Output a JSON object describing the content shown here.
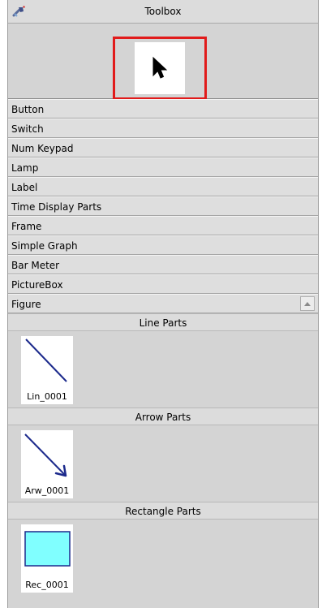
{
  "panel": {
    "title": "Toolbox",
    "title_icon": "toolbox-wrench-icon",
    "pointer_tool": "arrow-cursor-icon",
    "highlight_color": "#e11b1b"
  },
  "categories": [
    "Button",
    "Switch",
    "Num Keypad",
    "Lamp",
    "Label",
    "Time Display Parts",
    "Frame",
    "Simple Graph",
    "Bar Meter",
    "PictureBox",
    "Figure"
  ],
  "sections": [
    {
      "title": "Line Parts",
      "item": "Lin_0001",
      "icon": "line-part-icon"
    },
    {
      "title": "Arrow Parts",
      "item": "Arw_0001",
      "icon": "arrow-part-icon"
    },
    {
      "title": "Rectangle Parts",
      "item": "Rec_0001",
      "icon": "rectangle-part-icon",
      "fill_color": "#80ffff"
    }
  ]
}
